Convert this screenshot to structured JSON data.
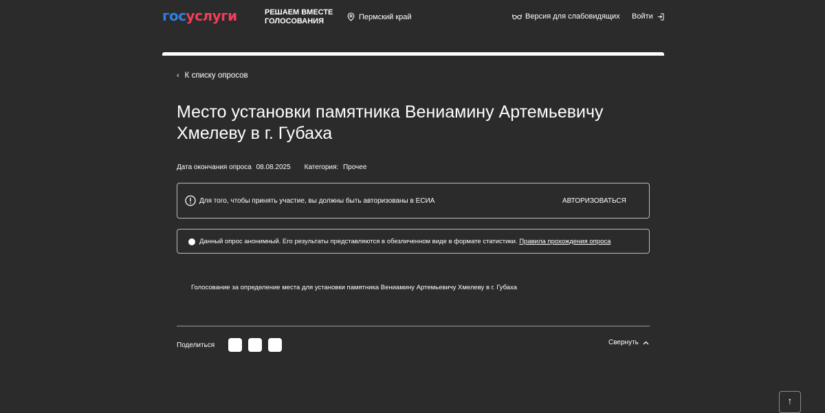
{
  "header": {
    "logo_part1": "гос",
    "logo_part2": "услуги",
    "slogan": "Решаем вместе голосования",
    "region": "Пермский край",
    "vision_mode": "Версия для слабовидящих",
    "login": "Войти"
  },
  "nav": {
    "back": "К списку опросов"
  },
  "poll": {
    "title": "Место установки памятника Вениамину Артемьевичу Хмелеву в г. Губаха",
    "end_date_label": "Дата окончания опроса",
    "end_date": "08.08.2025",
    "category_label": "Категория:",
    "category": "Прочее",
    "description": "Голосование за определение места для установки памятника Вениамину Артемьевичу Хмелеву в г. Губаха"
  },
  "auth_notice": {
    "text": "Для того, чтобы принять участие, вы должны быть авторизованы в ЕСИА",
    "button": "Авторизоваться"
  },
  "anon_notice": {
    "text": "Данный опрос анонимный. Его результаты представляются в обезличенном виде в формате статистики.",
    "link": "Правила прохождения опроса"
  },
  "footer": {
    "share_label": "Поделиться",
    "collapse_label": "Свернуть",
    "scroll_top": "↑"
  },
  "colors": {
    "background": "#2b2b2b",
    "logo_blue": "#2e7fe3",
    "logo_red": "#ee3f58",
    "text": "#ffffff"
  }
}
